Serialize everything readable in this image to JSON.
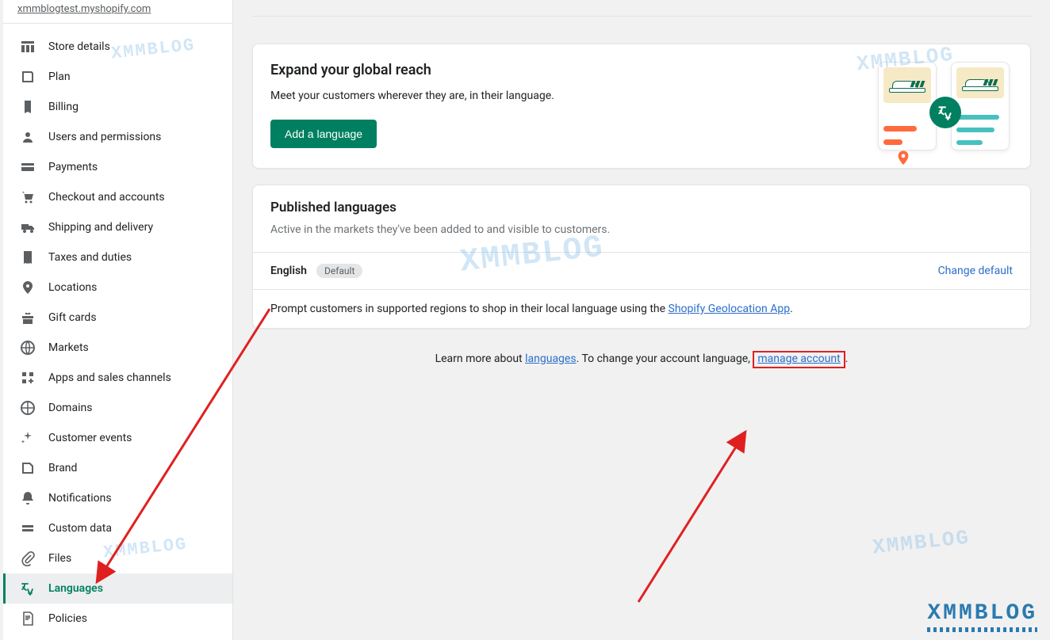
{
  "store_url": "xmmblogtest.myshopify.com",
  "sidebar": {
    "items": [
      {
        "label": "Store details"
      },
      {
        "label": "Plan"
      },
      {
        "label": "Billing"
      },
      {
        "label": "Users and permissions"
      },
      {
        "label": "Payments"
      },
      {
        "label": "Checkout and accounts"
      },
      {
        "label": "Shipping and delivery"
      },
      {
        "label": "Taxes and duties"
      },
      {
        "label": "Locations"
      },
      {
        "label": "Gift cards"
      },
      {
        "label": "Markets"
      },
      {
        "label": "Apps and sales channels"
      },
      {
        "label": "Domains"
      },
      {
        "label": "Customer events"
      },
      {
        "label": "Brand"
      },
      {
        "label": "Notifications"
      },
      {
        "label": "Custom data"
      },
      {
        "label": "Files"
      },
      {
        "label": "Languages"
      },
      {
        "label": "Policies"
      }
    ]
  },
  "hero": {
    "title": "Expand your global reach",
    "subtitle": "Meet your customers wherever they are, in their language.",
    "button": "Add a language"
  },
  "published": {
    "title": "Published languages",
    "desc": "Active in the markets they've been added to and visible to customers.",
    "language": "English",
    "badge": "Default",
    "change": "Change default",
    "note_pre": "Prompt customers in supported regions to shop in their local language using the ",
    "note_link": "Shopify Geolocation App",
    "note_post": "."
  },
  "footer": {
    "pre": "Learn more about ",
    "link1": "languages",
    "mid": ". To change your account language, ",
    "link2": "manage account",
    "post": "."
  },
  "watermark": "XMMBLOG"
}
